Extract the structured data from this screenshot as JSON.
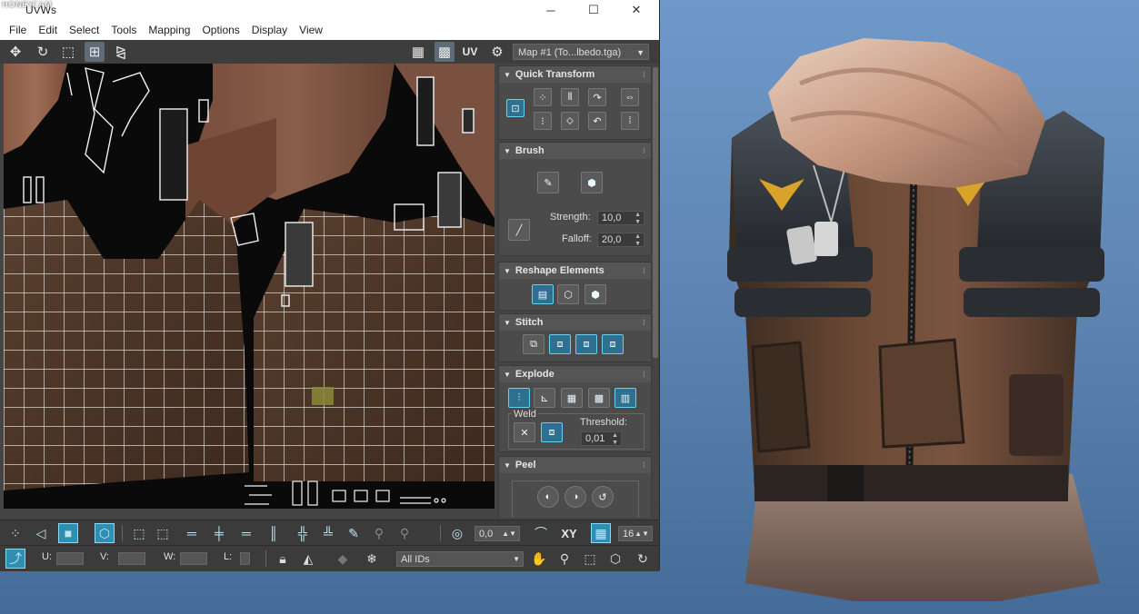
{
  "watermark": "HONEYCAM",
  "window": {
    "title": "UVWs",
    "controls": {
      "minimize": "─",
      "maximize": "☐",
      "close": "✕"
    },
    "menu": [
      "File",
      "Edit",
      "Select",
      "Tools",
      "Mapping",
      "Options",
      "Display",
      "View"
    ]
  },
  "toolbar": {
    "uv_label": "UV",
    "map_select": "Map #1 (To...lbedo.tga)"
  },
  "panel": {
    "quick_transform": {
      "title": "Quick Transform"
    },
    "brush": {
      "title": "Brush",
      "strength_label": "Strength:",
      "strength_value": "10,0",
      "falloff_label": "Falloff:",
      "falloff_value": "20,0"
    },
    "reshape": {
      "title": "Reshape Elements"
    },
    "stitch": {
      "title": "Stitch"
    },
    "explode": {
      "title": "Explode",
      "weld_label": "Weld",
      "threshold_label": "Threshold:",
      "threshold_value": "0,01"
    },
    "peel": {
      "title": "Peel"
    }
  },
  "bottom": {
    "angle_value": "0,0",
    "xy_label": "XY",
    "grid_value": "16",
    "u_label": "U:",
    "v_label": "V:",
    "w_label": "W:",
    "l_label": "L:",
    "ids_select": "All IDs"
  },
  "colors": {
    "accent": "#2f8fb3",
    "panel_bg": "#4b4b4b",
    "viewport_bg": "#0a0a0a",
    "scene_bg": "#5f86b4"
  }
}
